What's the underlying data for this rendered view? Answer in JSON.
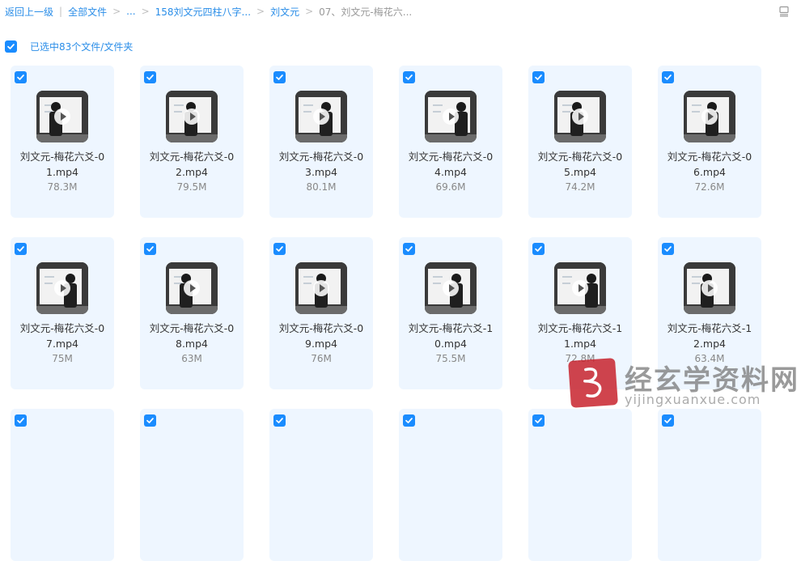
{
  "breadcrumb": {
    "back": "返回上一级",
    "all_files": "全部文件",
    "ellipsis": "...",
    "folder1": "158刘文元四柱八字...",
    "folder2": "刘文元",
    "current": "07、刘文元-梅花六..."
  },
  "selection": {
    "label": "已选中83个文件/文件夹",
    "checked": true
  },
  "files": [
    {
      "name": "刘文元-梅花六爻-01.mp4",
      "size": "78.3M",
      "checked": true
    },
    {
      "name": "刘文元-梅花六爻-02.mp4",
      "size": "79.5M",
      "checked": true
    },
    {
      "name": "刘文元-梅花六爻-03.mp4",
      "size": "80.1M",
      "checked": true
    },
    {
      "name": "刘文元-梅花六爻-04.mp4",
      "size": "69.6M",
      "checked": true
    },
    {
      "name": "刘文元-梅花六爻-05.mp4",
      "size": "74.2M",
      "checked": true
    },
    {
      "name": "刘文元-梅花六爻-06.mp4",
      "size": "72.6M",
      "checked": true
    },
    {
      "name": "刘文元-梅花六爻-07.mp4",
      "size": "75M",
      "checked": true
    },
    {
      "name": "刘文元-梅花六爻-08.mp4",
      "size": "63M",
      "checked": true
    },
    {
      "name": "刘文元-梅花六爻-09.mp4",
      "size": "76M",
      "checked": true
    },
    {
      "name": "刘文元-梅花六爻-10.mp4",
      "size": "75.5M",
      "checked": true
    },
    {
      "name": "刘文元-梅花六爻-11.mp4",
      "size": "72.8M",
      "checked": true
    },
    {
      "name": "刘文元-梅花六爻-12.mp4",
      "size": "63.4M",
      "checked": true
    },
    {
      "name": "",
      "size": "",
      "checked": true
    },
    {
      "name": "",
      "size": "",
      "checked": true
    },
    {
      "name": "",
      "size": "",
      "checked": true
    },
    {
      "name": "",
      "size": "",
      "checked": true
    },
    {
      "name": "",
      "size": "",
      "checked": true
    },
    {
      "name": "",
      "size": "",
      "checked": true
    }
  ],
  "watermark": {
    "cn": "经玄学资料网",
    "url": "yijingxuanxue.com"
  },
  "colors": {
    "accent": "#1a8cff",
    "card_bg": "#eef6ff",
    "link": "#2b8ee8"
  },
  "icons": {
    "view_toggle": "list-view-icon",
    "checkbox": "check-icon",
    "play": "play-icon"
  }
}
